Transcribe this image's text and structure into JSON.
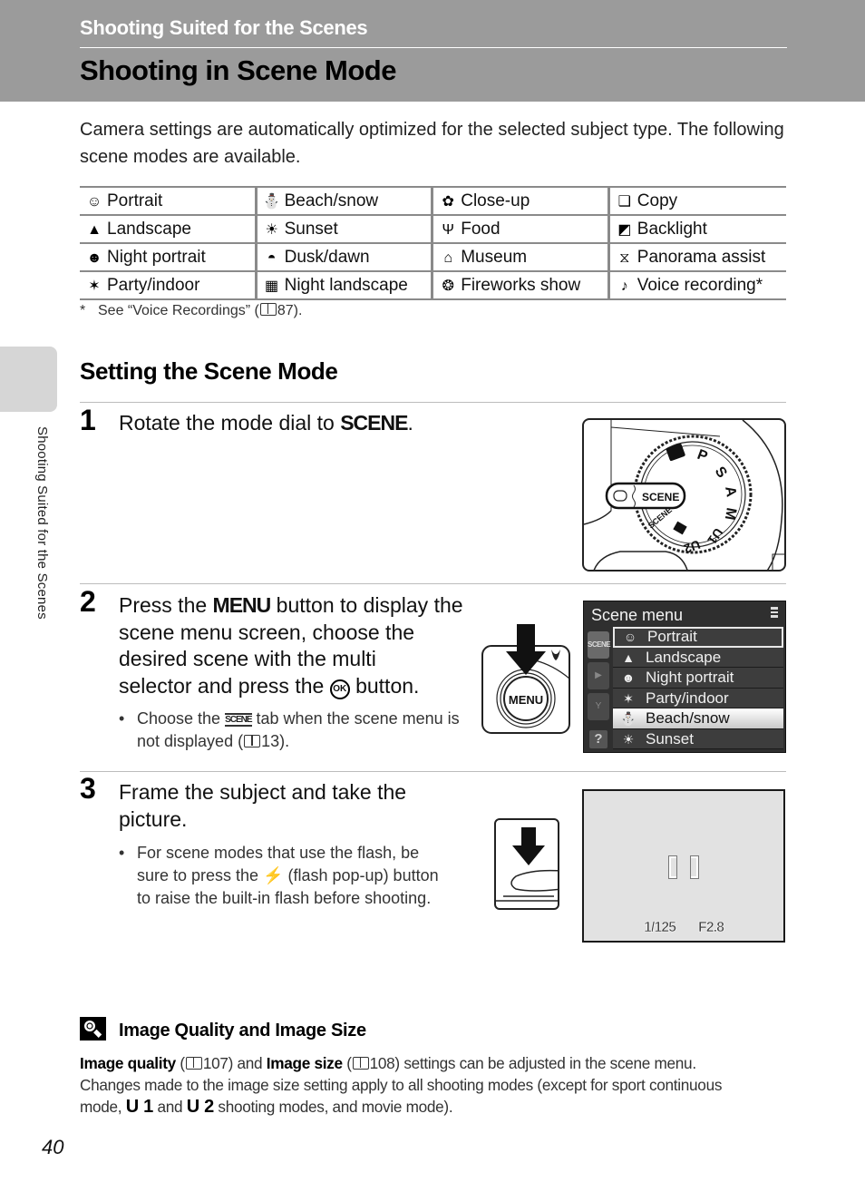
{
  "header": {
    "section": "Shooting Suited for the Scenes",
    "title": "Shooting in Scene Mode"
  },
  "side_tab": {
    "label": "Shooting Suited for the Scenes"
  },
  "intro": "Camera settings are automatically optimized for the selected subject type. The following scene modes are available.",
  "scene_modes": [
    [
      {
        "icon": "portrait-icon",
        "glyph": "☺",
        "label": "Portrait"
      },
      {
        "icon": "beach-snow-icon",
        "glyph": "⛄",
        "label": "Beach/snow"
      },
      {
        "icon": "close-up-icon",
        "glyph": "✿",
        "label": "Close-up"
      },
      {
        "icon": "copy-icon",
        "glyph": "❑",
        "label": "Copy"
      }
    ],
    [
      {
        "icon": "landscape-icon",
        "glyph": "▲",
        "label": "Landscape"
      },
      {
        "icon": "sunset-icon",
        "glyph": "☀",
        "label": "Sunset"
      },
      {
        "icon": "food-icon",
        "glyph": "Ψ",
        "label": "Food"
      },
      {
        "icon": "backlight-icon",
        "glyph": "◩",
        "label": "Backlight"
      }
    ],
    [
      {
        "icon": "night-portrait-icon",
        "glyph": "☻",
        "label": "Night portrait"
      },
      {
        "icon": "dusk-dawn-icon",
        "glyph": "◓",
        "label": "Dusk/dawn"
      },
      {
        "icon": "museum-icon",
        "glyph": "⌂",
        "label": "Museum"
      },
      {
        "icon": "panorama-assist-icon",
        "glyph": "⧖",
        "label": "Panorama assist"
      }
    ],
    [
      {
        "icon": "party-indoor-icon",
        "glyph": "✶",
        "label": "Party/indoor"
      },
      {
        "icon": "night-landscape-icon",
        "glyph": "▦",
        "label": "Night landscape"
      },
      {
        "icon": "fireworks-show-icon",
        "glyph": "❂",
        "label": "Fireworks show"
      },
      {
        "icon": "voice-recording-icon",
        "glyph": "♪",
        "label": "Voice recording*"
      }
    ]
  ],
  "footnote": {
    "star": "*",
    "text_before": "See “Voice Recordings” (",
    "page": "87",
    "text_after": ")."
  },
  "setting_section": {
    "title": "Setting the Scene Mode"
  },
  "steps": [
    {
      "number": "1",
      "text_before": "Rotate the mode dial to ",
      "keyword": "SCENE",
      "text_after": "."
    },
    {
      "number": "2",
      "line1_before": "Press the ",
      "line1_keyword": "MENU",
      "line1_after": " button to display the",
      "line2": "scene menu screen, choose the",
      "line3": "desired scene with the multi",
      "line4_before": "selector and press the ",
      "line4_ok": "OK",
      "line4_after": " button.",
      "bullet_before": "Choose the ",
      "bullet_chip": "SCENE",
      "bullet_mid": " tab when the scene menu is",
      "bullet_line2_before": "not displayed (",
      "bullet_page": "13",
      "bullet_line2_after": ")."
    },
    {
      "number": "3",
      "line1": "Frame the subject and take the",
      "line2": "picture.",
      "bullet_line1": "For scene modes that use the flash, be",
      "bullet_line2_before": "sure to press the ",
      "bullet_flash": "⚡",
      "bullet_line2_after": " (flash pop-up) button",
      "bullet_line3": "to raise the built-in flash before shooting."
    }
  ],
  "mode_dial": {
    "window_label": "SCENE",
    "marks": [
      "P",
      "S",
      "A",
      "M",
      "U1",
      "U2"
    ],
    "secondary_label": "SCENE"
  },
  "menu_button": {
    "label": "MENU"
  },
  "scene_menu": {
    "title": "Scene menu",
    "tabs": [
      {
        "name": "scene-tab",
        "label": "SCENE",
        "active": true
      },
      {
        "name": "playback-tab",
        "label": "▶",
        "active": false
      },
      {
        "name": "setup-tab",
        "label": "Y",
        "active": false
      }
    ],
    "help": "?",
    "items": [
      {
        "glyph": "☺",
        "label": "Portrait",
        "state": "current"
      },
      {
        "glyph": "▲",
        "label": "Landscape",
        "state": ""
      },
      {
        "glyph": "☻",
        "label": "Night portrait",
        "state": ""
      },
      {
        "glyph": "✶",
        "label": "Party/indoor",
        "state": ""
      },
      {
        "glyph": "⛄",
        "label": "Beach/snow",
        "state": "highlight"
      },
      {
        "glyph": "☀",
        "label": "Sunset",
        "state": ""
      }
    ]
  },
  "lcd": {
    "shutter": "1/125",
    "aperture": "F2.8"
  },
  "tip": {
    "title": "Image Quality and Image Size",
    "b1": "Image quality",
    "p1_open": " (",
    "p1_page": "107",
    "p1_close": ") and ",
    "b2": "Image size",
    "p2_open": " (",
    "p2_page": "108",
    "p2_close": ") settings can be adjusted in the scene menu.",
    "line2": "Changes made to the image size setting apply to all shooting modes (except for sport continuous",
    "line3_before": "mode, ",
    "u1": "U 1",
    "line3_and": " and ",
    "u2": "U 2",
    "line3_after": " shooting modes, and movie mode)."
  },
  "page_number": "40"
}
